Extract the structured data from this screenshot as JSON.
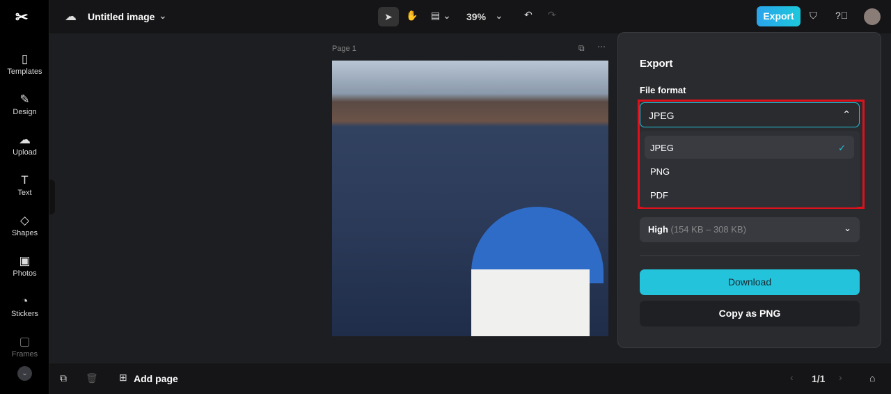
{
  "app": {
    "title": "Untitled image",
    "zoom": "39%",
    "export_label": "Export"
  },
  "sidebar": {
    "items": [
      {
        "label": "Templates",
        "icon": "▯"
      },
      {
        "label": "Design",
        "icon": "✎"
      },
      {
        "label": "Upload",
        "icon": "☁"
      },
      {
        "label": "Text",
        "icon": "T"
      },
      {
        "label": "Shapes",
        "icon": "◇"
      },
      {
        "label": "Photos",
        "icon": "▣"
      },
      {
        "label": "Stickers",
        "icon": "◔"
      },
      {
        "label": "Frames",
        "icon": "▢"
      }
    ]
  },
  "canvas": {
    "page_label": "Page 1"
  },
  "bottom": {
    "add_page": "Add page",
    "page_count": "1/1"
  },
  "export_panel": {
    "title": "Export",
    "file_format_label": "File format",
    "selected_format": "JPEG",
    "options": [
      "JPEG",
      "PNG",
      "PDF"
    ],
    "quality": "High",
    "quality_range": "(154 KB – 308 KB)",
    "download": "Download",
    "copy": "Copy as PNG"
  },
  "colors": {
    "accent": "#22c3db",
    "highlight": "#e0101a"
  }
}
